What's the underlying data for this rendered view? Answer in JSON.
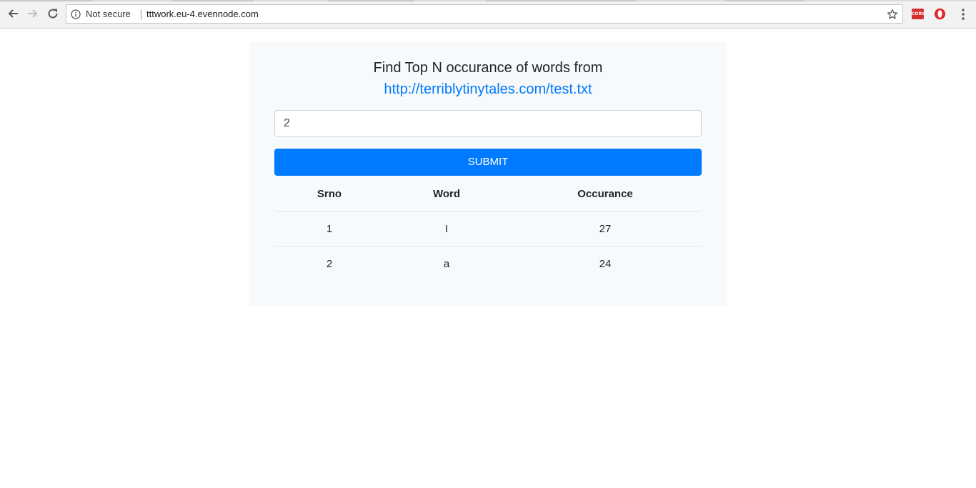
{
  "browser": {
    "security_label": "Not secure",
    "url": "tttwork.eu-4.evennode.com",
    "extensions": [
      {
        "name": "cors-extension",
        "label": "CORS",
        "color": "#d32f2f"
      },
      {
        "name": "opera-extension",
        "icon": "opera-icon",
        "color": "#e5232a"
      }
    ]
  },
  "page": {
    "heading": "Find Top N occurance of words from",
    "source_link": "http://terriblytinytales.com/test.txt",
    "input_value": "2",
    "submit_label": "SUBMIT",
    "accent_color": "#007bff"
  },
  "table": {
    "headers": [
      "Srno",
      "Word",
      "Occurance"
    ],
    "rows": [
      [
        "1",
        "I",
        "27"
      ],
      [
        "2",
        "a",
        "24"
      ]
    ]
  }
}
